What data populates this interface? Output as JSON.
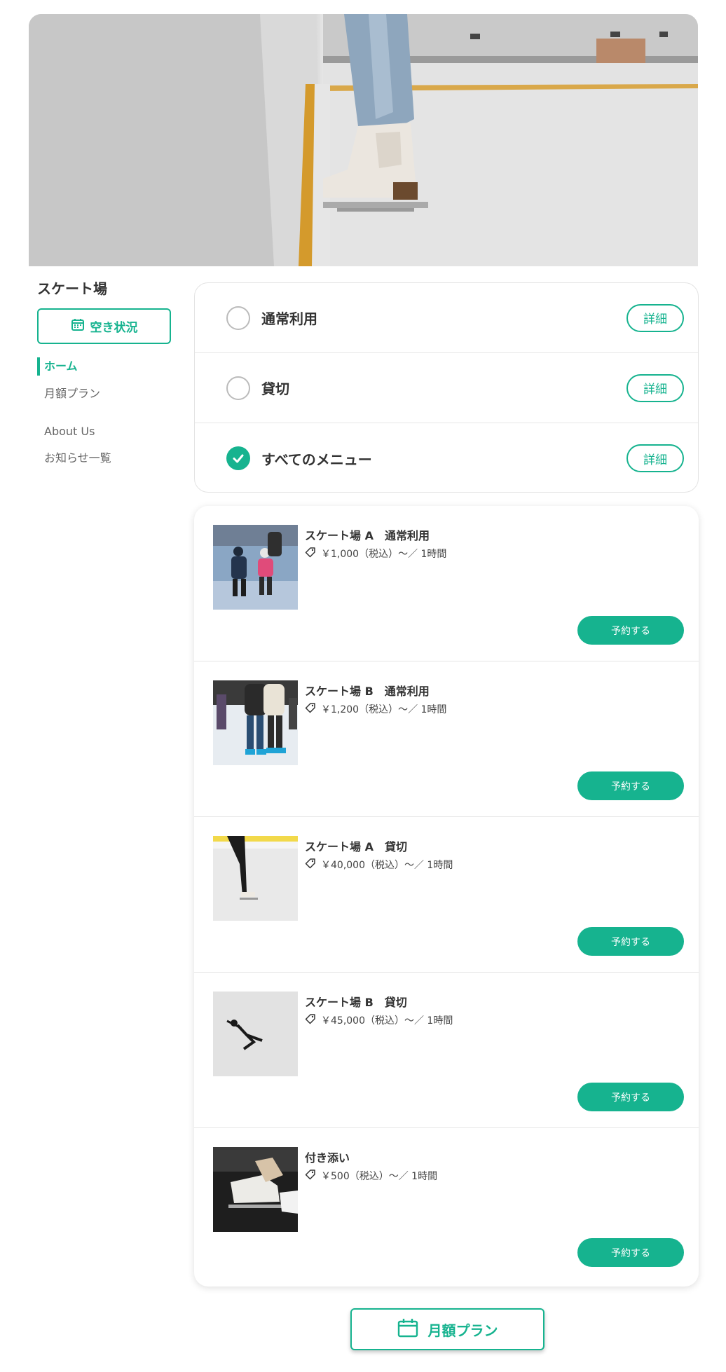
{
  "colors": {
    "accent": "#16b38f",
    "text": "#333333",
    "muted": "#666666",
    "border": "#e6e6e6"
  },
  "venue": {
    "name": "スケート場"
  },
  "sidebar": {
    "availability_label": "空き状況",
    "availability_icon": "calendar-icon",
    "nav_items": [
      {
        "label": "ホーム",
        "active": true
      },
      {
        "label": "月額プラン",
        "active": false
      },
      {
        "label": "About Us",
        "active": false
      },
      {
        "label": "お知らせ一覧",
        "active": false
      }
    ]
  },
  "filters": [
    {
      "label": "通常利用",
      "checked": false,
      "detail_label": "詳細"
    },
    {
      "label": "貸切",
      "checked": false,
      "detail_label": "詳細"
    },
    {
      "label": "すべてのメニュー",
      "checked": true,
      "detail_label": "詳細"
    }
  ],
  "plans": [
    {
      "name": "スケート場 A　通常利用",
      "price": "￥1,000（税込）〜／ 1時間",
      "reserve_label": "予約する",
      "price_icon": "tag-icon"
    },
    {
      "name": "スケート場 B　通常利用",
      "price": "￥1,200（税込）〜／ 1時間",
      "reserve_label": "予約する",
      "price_icon": "tag-icon"
    },
    {
      "name": "スケート場 A　貸切",
      "price": "￥40,000（税込）〜／ 1時間",
      "reserve_label": "予約する",
      "price_icon": "tag-icon"
    },
    {
      "name": "スケート場 B　貸切",
      "price": "￥45,000（税込）〜／ 1時間",
      "reserve_label": "予約する",
      "price_icon": "tag-icon"
    },
    {
      "name": "付き添い",
      "price": "￥500（税込）〜／ 1時間",
      "reserve_label": "予約する",
      "price_icon": "tag-icon"
    }
  ],
  "monthly_button": {
    "label": "月額プラン",
    "icon": "calendar-icon"
  }
}
